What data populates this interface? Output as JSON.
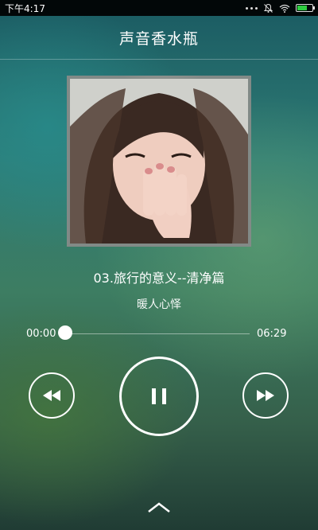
{
  "status_bar": {
    "time": "下午4:17",
    "icons": [
      "more-dots-icon",
      "mute-icon",
      "wifi-icon",
      "battery-icon"
    ],
    "battery_level": 0.6
  },
  "header": {
    "title": "声音香水瓶"
  },
  "album": {
    "icon": "album-cover-image"
  },
  "track": {
    "title": "03.旅行的意义--清净篇",
    "artist": "暖人心怿"
  },
  "progress": {
    "current": "00:00",
    "total": "06:29",
    "fraction": 0.0
  },
  "controls": {
    "prev_icon": "rewind-icon",
    "play_icon": "pause-icon",
    "next_icon": "fast-forward-icon",
    "expand_icon": "chevron-up-icon"
  },
  "colors": {
    "accent": "#ffffff",
    "status_bar_bg": "#000000",
    "battery_fill": "#2ecc40"
  }
}
